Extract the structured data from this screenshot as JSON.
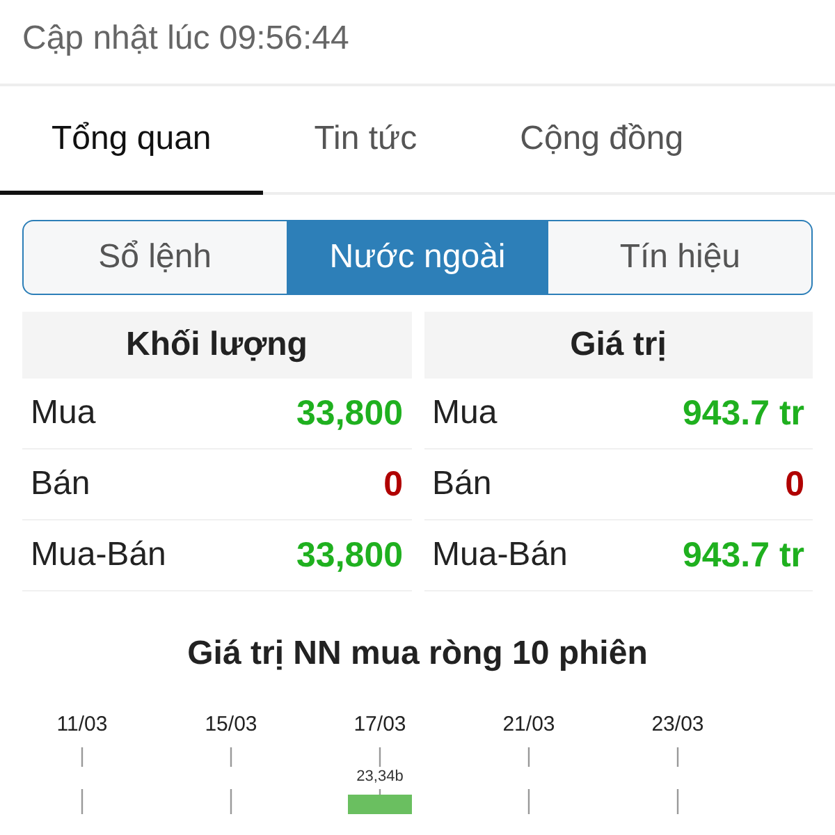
{
  "update_line": "Cập nhật lúc 09:56:44",
  "tabs": [
    {
      "label": "Tổng quan",
      "selected": true
    },
    {
      "label": "Tin tức",
      "selected": false
    },
    {
      "label": "Cộng đồng",
      "selected": false
    }
  ],
  "segments": [
    {
      "label": "Sổ lệnh",
      "selected": false
    },
    {
      "label": "Nước ngoài",
      "selected": true
    },
    {
      "label": "Tín hiệu",
      "selected": false
    }
  ],
  "tables": [
    {
      "title": "Khối lượng",
      "rows": [
        {
          "label": "Mua",
          "value": "33,800",
          "color": "#1fb01f"
        },
        {
          "label": "Bán",
          "value": "0",
          "color": "#b00000"
        },
        {
          "label": "Mua-Bán",
          "value": "33,800",
          "color": "#1fb01f"
        }
      ]
    },
    {
      "title": "Giá trị",
      "rows": [
        {
          "label": "Mua",
          "value": "943.7 tr",
          "color": "#1fb01f"
        },
        {
          "label": "Bán",
          "value": "0",
          "color": "#b00000"
        },
        {
          "label": "Mua-Bán",
          "value": "943.7 tr",
          "color": "#1fb01f"
        }
      ]
    }
  ],
  "chart": {
    "chart_data": {
      "type": "bar",
      "title": "Giá trị NN mua ròng 10 phiên",
      "categories": [
        "11/03",
        "15/03",
        "17/03",
        "21/03",
        "23/03"
      ],
      "values": [
        null,
        null,
        23.34,
        null,
        null
      ],
      "value_labels": [
        null,
        null,
        "23,34b",
        null,
        null
      ],
      "grid": true
    }
  }
}
